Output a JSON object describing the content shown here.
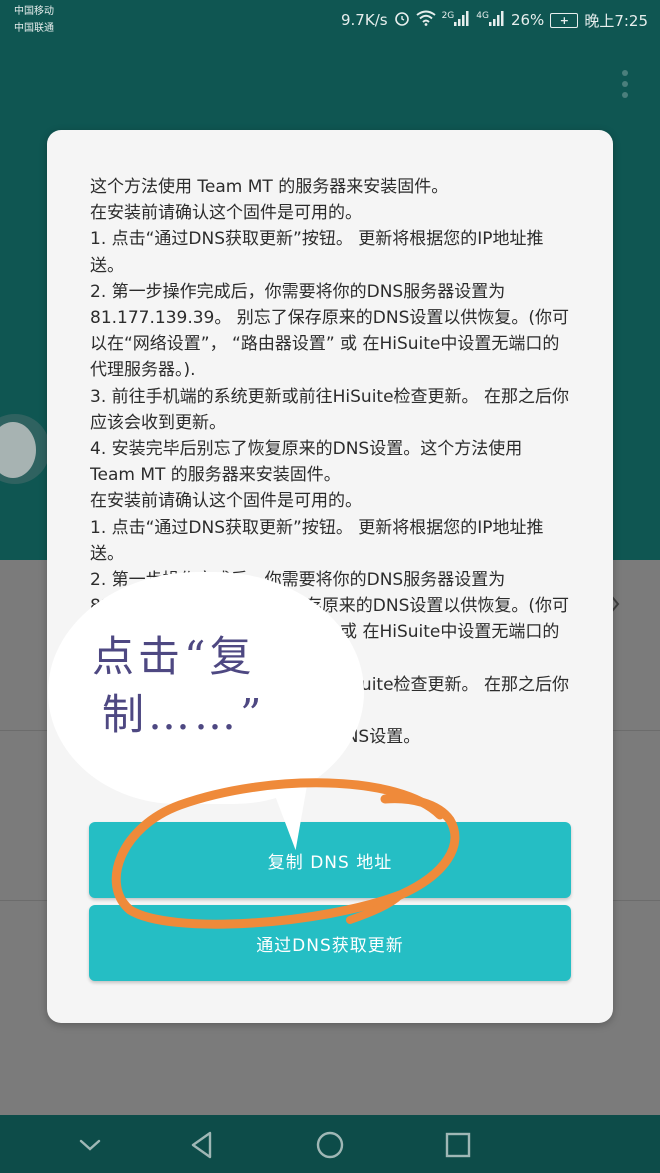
{
  "status_bar": {
    "carrier_1": "中国移动",
    "carrier_2": "中国联通",
    "speed": "9.7K/s",
    "network_2g": "2G",
    "network_4g": "4G",
    "battery": "26%",
    "time": "晚上7:25"
  },
  "dialog": {
    "paragraphs": [
      "这个方法使用 Team MT 的服务器来安装固件。",
      "在安装前请确认这个固件是可用的。",
      "1. 点击“通过DNS获取更新”按钮。 更新将根据您的IP地址推送。",
      "2. 第一步操作完成后，你需要将你的DNS服务器设置为 81.177.139.39。 别忘了保存原来的DNS设置以供恢复。(你可以在“网络设置”， “路由器设置” 或 在HiSuite中设置无端口的代理服务器。).",
      "3. 前往手机端的系统更新或前往HiSuite检查更新。 在那之后你应该会收到更新。",
      "4. 安装完毕后别忘了恢复原来的DNS设置。这个方法使用 Team MT 的服务器来安装固件。",
      "在安装前请确认这个固件是可用的。",
      "1. 点击“通过DNS获取更新”按钮。 更新将根据您的IP地址推送。",
      "2. 第一步操作完成后，你需要将你的DNS服务器设置为 81.177.139.39。 别忘了保存原来的DNS设置以供恢复。(你可以在“网络设置”， “路由器设置” 或 在HiSuite中设置无端口的代理服务器。).",
      "3. 前往手机端的系统更新或前往HiSuite检查更新。 在那之后你应该会收到更新。",
      "4. 安装完毕后别忘了恢复原来的DNS设置。"
    ],
    "copy_button": "复制 DNS 地址",
    "get_button": "通过DNS获取更新"
  },
  "annotation": {
    "line_1": "点击“复",
    "line_2": "制……”"
  },
  "colors": {
    "header_teal": "#0f5652",
    "button_cyan": "#25bec4",
    "annotation_orange": "#ef8a3a",
    "annotation_text": "#4e4882"
  }
}
